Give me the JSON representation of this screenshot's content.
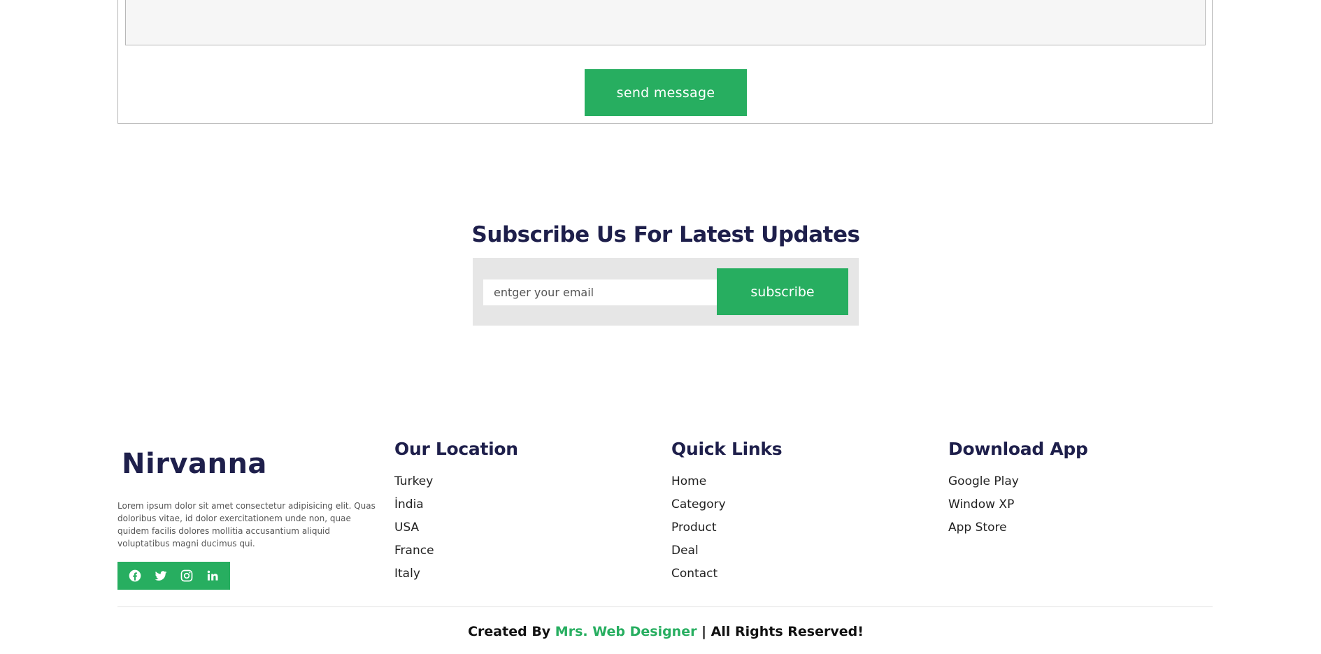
{
  "contact": {
    "send_label": "send message"
  },
  "subscribe": {
    "title": "Subscribe Us For Latest Updates",
    "email_placeholder": "entger your email",
    "button_label": "subscribe"
  },
  "footer": {
    "brand": "Nirvanna",
    "about": "Lorem ipsum dolor sit amet consectetur adipisicing elit. Quas doloribus vitae, id dolor exercitationem unde non, quae quidem facilis dolores mollitia accusantium aliquid voluptatibus magni ducimus qui.",
    "socials": [
      "facebook-icon",
      "twitter-icon",
      "instagram-icon",
      "linkedin-icon"
    ],
    "location": {
      "title": "Our Location",
      "items": [
        "Turkey",
        "İndia",
        "USA",
        "France",
        "Italy"
      ]
    },
    "quick_links": {
      "title": "Quick Links",
      "items": [
        "Home",
        "Category",
        "Product",
        "Deal",
        "Contact"
      ]
    },
    "download": {
      "title": "Download App",
      "items": [
        "Google Play",
        "Window XP",
        "App Store"
      ]
    },
    "credit": {
      "prefix": "Created By ",
      "author": "Mrs. Web Designer",
      "suffix": " | All Rights Reserved!"
    }
  },
  "colors": {
    "accent": "#27ae60",
    "heading": "#1e1f4b",
    "subscribe_bg": "#e6e6e6"
  }
}
